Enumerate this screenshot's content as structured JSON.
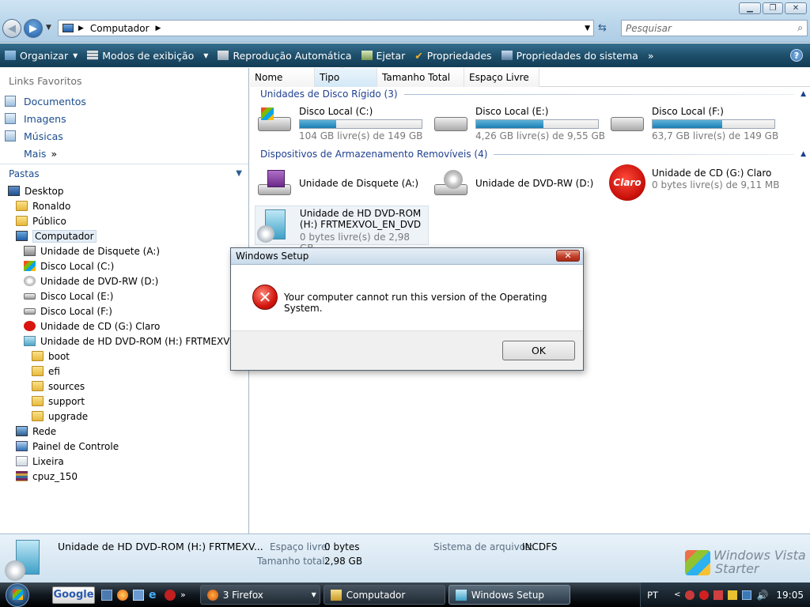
{
  "address": {
    "location": "Computador"
  },
  "search": {
    "placeholder": "Pesquisar"
  },
  "toolbar": {
    "organize": "Organizar",
    "views": "Modos de exibição",
    "autoplay": "Reprodução Automática",
    "eject": "Ejetar",
    "properties": "Propriedades",
    "system_properties": "Propriedades do sistema",
    "more": "»"
  },
  "nav": {
    "favorites_header": "Links Favoritos",
    "favorites": [
      "Documentos",
      "Imagens",
      "Músicas"
    ],
    "more_label": "Mais",
    "folders_header": "Pastas",
    "tree": [
      "Desktop",
      "Ronaldo",
      "Público",
      "Computador",
      "Unidade de Disquete (A:)",
      "Disco Local (C:)",
      "Unidade de DVD-RW (D:)",
      "Disco Local (E:)",
      "Disco Local (F:)",
      "Unidade de CD (G:) Claro",
      "Unidade de HD DVD-ROM (H:) FRTMEXVOL_EN_DVD",
      "boot",
      "efi",
      "sources",
      "support",
      "upgrade",
      "Rede",
      "Painel de Controle",
      "Lixeira",
      "cpuz_150"
    ]
  },
  "columns": [
    "Nome",
    "Tipo",
    "Tamanho Total",
    "Espaço Livre"
  ],
  "groups": {
    "hard_disks": "Unidades de Disco Rígido (3)",
    "removable": "Dispositivos de Armazenamento Removíveis (4)"
  },
  "drives": [
    {
      "name": "Disco Local (C:)",
      "free": "104 GB livre(s) de 149 GB",
      "used_fraction": 0.3
    },
    {
      "name": "Disco Local (E:)",
      "free": "4,26 GB livre(s) de 9,55 GB",
      "used_fraction": 0.55
    },
    {
      "name": "Disco Local (F:)",
      "free": "63,7 GB livre(s) de 149 GB",
      "used_fraction": 0.57
    }
  ],
  "removable": [
    {
      "name": "Unidade de Disquete (A:)"
    },
    {
      "name": "Unidade de DVD-RW (D:)"
    },
    {
      "name": "Unidade de CD (G:) Claro",
      "free": "0 bytes livre(s) de 9,11 MB",
      "logo": "Claro"
    },
    {
      "name_line1": "Unidade de HD DVD-ROM",
      "name_line2": "(H:) FRTMEXVOL_EN_DVD",
      "free": "0 bytes livre(s) de 2,98 GB"
    }
  ],
  "details": {
    "title": "Unidade de HD DVD-ROM (H:) FRTMEXV...",
    "free_label": "Espaço livre:",
    "free_value": "0 bytes",
    "total_label": "Tamanho total:",
    "total_value": "2,98 GB",
    "fs_label": "Sistema de arquivos:",
    "fs_value": "INCDFS",
    "brand_line1": "Windows Vista",
    "brand_line2": "Starter"
  },
  "dialog": {
    "title": "Windows Setup",
    "message": "Your computer cannot run this version of the Operating System.",
    "ok": "OK"
  },
  "taskbar": {
    "search_label": "Google",
    "tasks": [
      "3 Firefox",
      "Computador",
      "Windows Setup"
    ],
    "lang": "PT",
    "time": "19:05"
  },
  "colors": {
    "toolbar": "#1e4f6b",
    "link": "#1a4d8f",
    "group": "#1e3f90",
    "error": "#d4160f"
  }
}
